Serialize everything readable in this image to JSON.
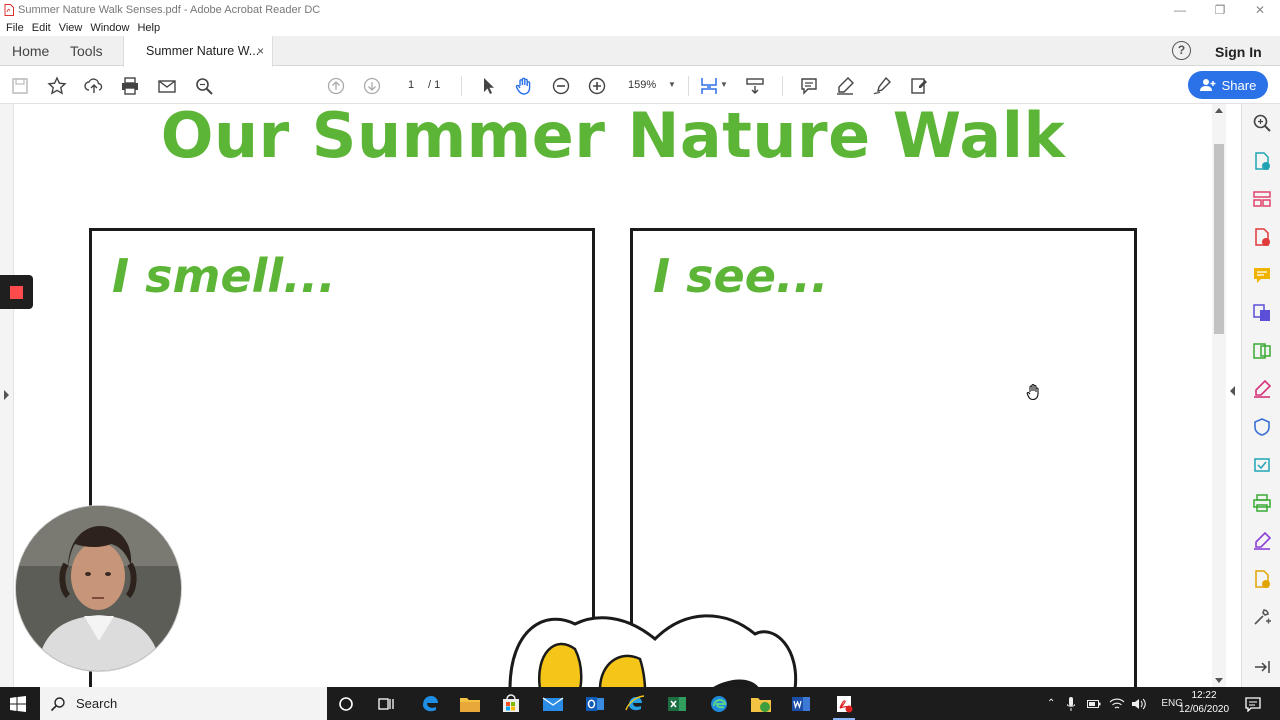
{
  "window": {
    "title": "Summer Nature Walk Senses.pdf - Adobe Acrobat Reader DC",
    "controls": [
      "minimize-icon",
      "restore-icon",
      "close-icon"
    ]
  },
  "menu": {
    "items": [
      "File",
      "Edit",
      "View",
      "Window",
      "Help"
    ]
  },
  "tabs": {
    "home": "Home",
    "tools": "Tools",
    "document": "Summer Nature W...",
    "close": "×",
    "help": "?",
    "signin": "Sign In"
  },
  "toolbar": {
    "icons": [
      "save-icon",
      "bookmark-star-icon",
      "upload-icon",
      "print-icon",
      "email-icon",
      "find-icon",
      "page-up-icon",
      "page-down-icon",
      "select-cursor-icon",
      "hand-icon",
      "zoom-out-icon",
      "zoom-in-icon",
      "fit-page-icon",
      "scroll-mode-icon",
      "comment-icon",
      "highlight-icon",
      "sign-icon",
      "fill-sign-icon"
    ],
    "page_current": "1",
    "page_total": "/ 1",
    "zoom": "159%",
    "share": "Share"
  },
  "document": {
    "title": "Our Summer Nature Walk",
    "box_left": "I smell...",
    "box_right": "I see..."
  },
  "right_panel": {
    "icons": [
      "search-zoom-icon",
      "create-pdf-icon",
      "organize-pages-icon",
      "export-pdf-icon",
      "comment-tool-icon",
      "combine-files-icon",
      "edit-pdf-icon",
      "fill-sign-tool-icon",
      "protect-icon",
      "send-for-review-icon",
      "print-production-icon",
      "sign-tool-icon",
      "more-tools-icon",
      "customize-icon",
      "collapse-panel-icon"
    ]
  },
  "taskbar": {
    "search": "Search",
    "apps": [
      "cortana-icon",
      "task-view-icon",
      "edge-legacy-icon",
      "file-explorer-icon",
      "store-icon",
      "mail-icon",
      "outlook-icon",
      "ie-icon",
      "excel-icon",
      "edge-icon",
      "explorer-share-icon",
      "word-icon",
      "acrobat-icon"
    ],
    "tray_lang": "ENG",
    "time": "12:22",
    "date": "12/06/2020"
  },
  "colors": {
    "accent": "#2b71e8",
    "title_green": "#5cb536",
    "record_red": "#ff4b4b"
  }
}
